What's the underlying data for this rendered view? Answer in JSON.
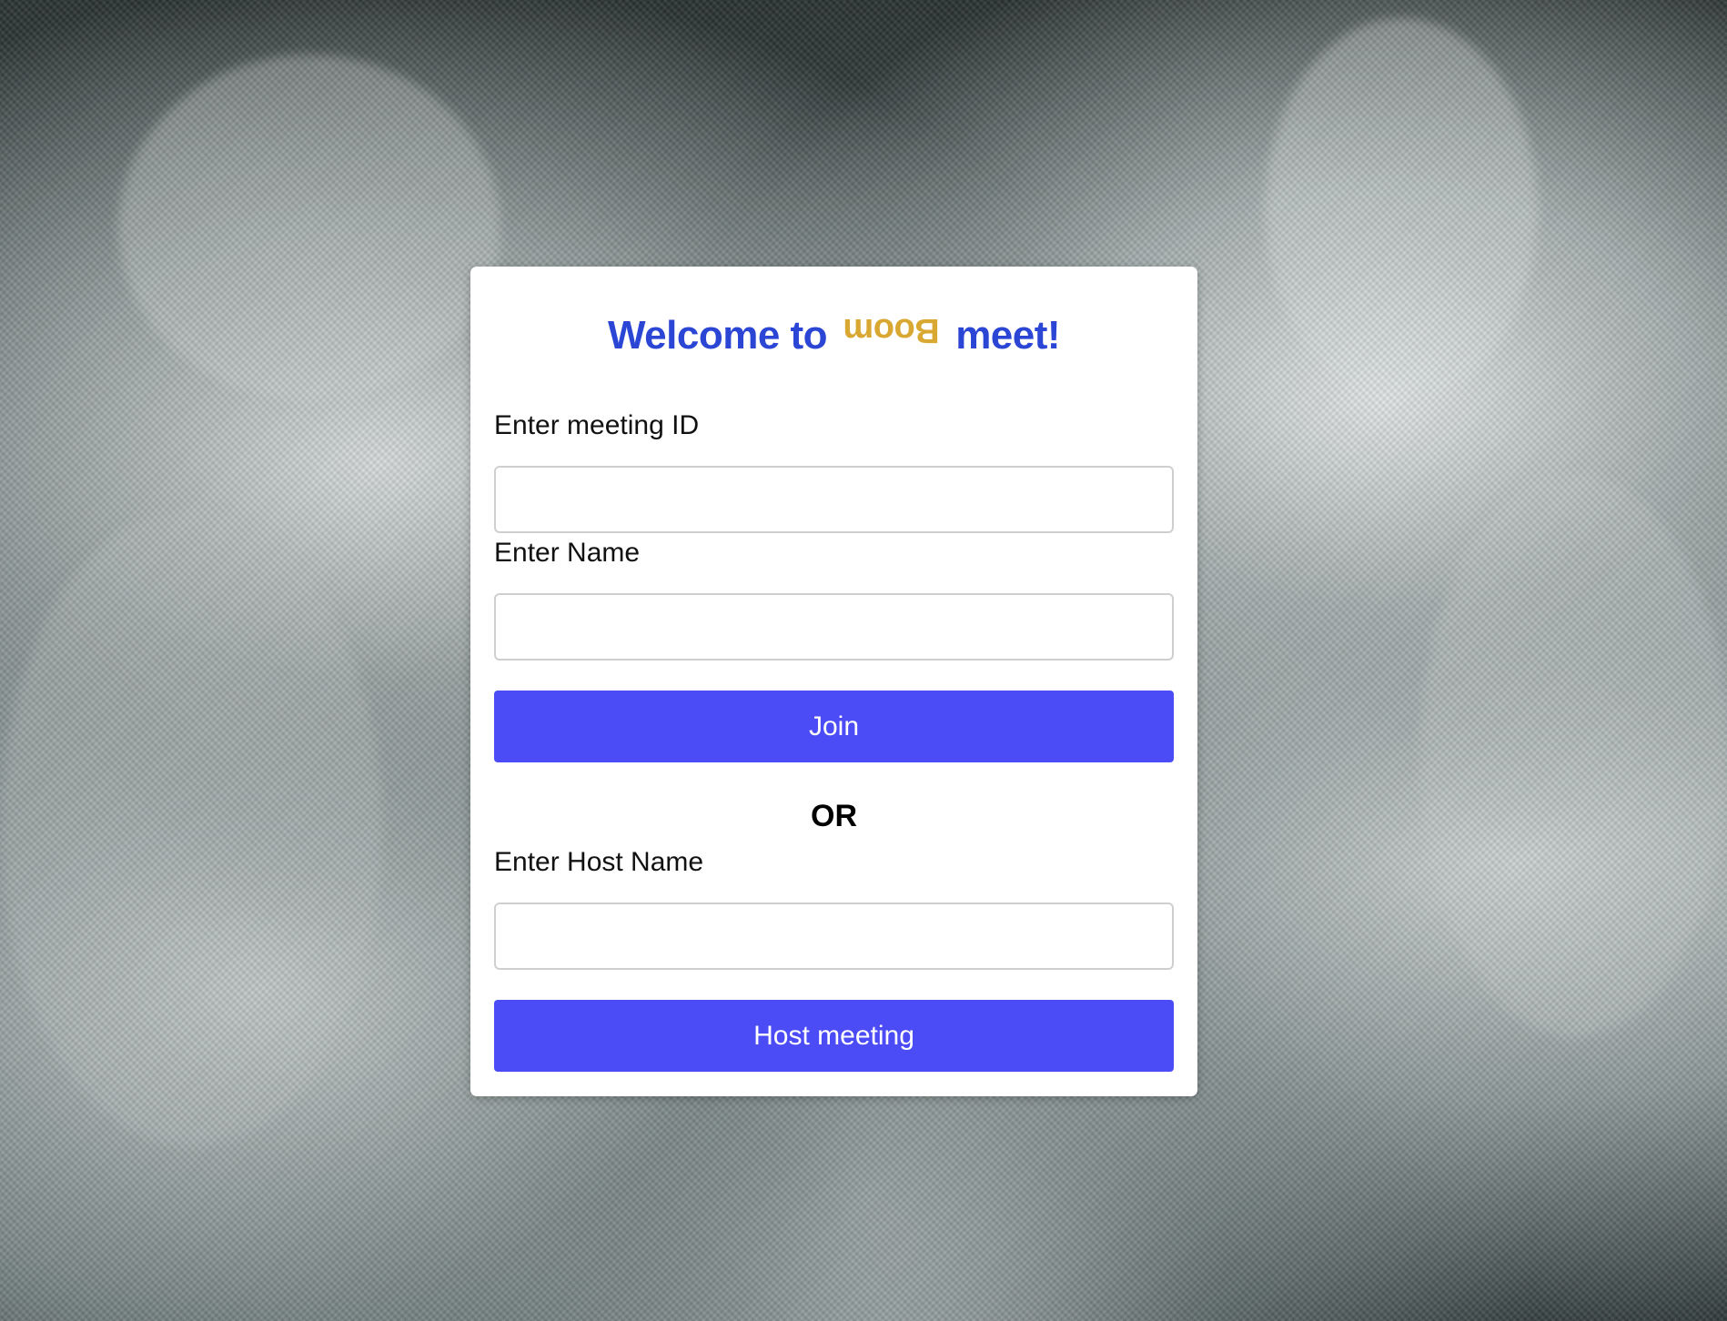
{
  "title": {
    "prefix": "Welcome to",
    "brand": "Boom",
    "suffix": "meet!"
  },
  "join": {
    "meeting_id_label": "Enter meeting ID",
    "meeting_id_value": "",
    "name_label": "Enter Name",
    "name_value": "",
    "button_label": "Join"
  },
  "divider": {
    "label": "OR"
  },
  "host": {
    "host_name_label": "Enter Host Name",
    "host_name_value": "",
    "button_label": "Host meeting"
  },
  "colors": {
    "title": "#2b46d4",
    "brand": "#d9a832",
    "button": "#4c4cf6"
  }
}
